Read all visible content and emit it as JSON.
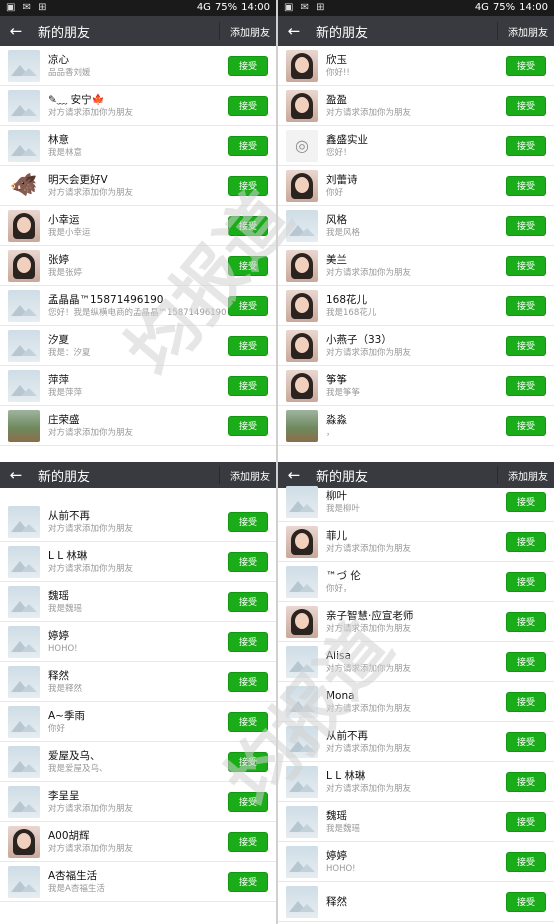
{
  "status_bar": {
    "battery": "75%",
    "time": "14:00",
    "network": "4G"
  },
  "header": {
    "title": "新的朋友",
    "action": "添加朋友"
  },
  "accept_label": "接受",
  "panels": [
    {
      "id": "top-left",
      "rows": [
        {
          "name": "凉心",
          "sub": "品品香刘媛",
          "avatar": "placeholder"
        },
        {
          "name": "✎﹏ 安宁🍁",
          "sub": "对方请求添加你为朋友",
          "avatar": "placeholder"
        },
        {
          "name": "林意",
          "sub": "我是林意",
          "avatar": "placeholder"
        },
        {
          "name": "明天会更好V",
          "sub": "对方请求添加你为朋友",
          "avatar": "animal"
        },
        {
          "name": "小幸运",
          "sub": "我是小幸运",
          "avatar": "person"
        },
        {
          "name": "张婷",
          "sub": "我是张婷",
          "avatar": "person"
        },
        {
          "name": "孟晶晶™15871496190",
          "sub": "您好！我是纵横电商的孟晶晶™15871496190",
          "avatar": "placeholder"
        },
        {
          "name": "汐夏",
          "sub": "我是：汐夏",
          "avatar": "placeholder"
        },
        {
          "name": "萍萍",
          "sub": "我是萍萍",
          "avatar": "placeholder"
        },
        {
          "name": "庄荣盛",
          "sub": "对方请求添加你为朋友",
          "avatar": "scenery"
        }
      ]
    },
    {
      "id": "top-right",
      "rows": [
        {
          "name": "欣玉",
          "sub": "你好!!",
          "avatar": "person"
        },
        {
          "name": "盈盈",
          "sub": "对方请求添加你为朋友",
          "avatar": "person"
        },
        {
          "name": "鑫盛实业",
          "sub": "您好！",
          "avatar": "logo"
        },
        {
          "name": "刘蕾诗",
          "sub": "你好",
          "avatar": "person"
        },
        {
          "name": "风格",
          "sub": "我是风格",
          "avatar": "placeholder"
        },
        {
          "name": "美兰",
          "sub": "对方请求添加你为朋友",
          "avatar": "person"
        },
        {
          "name": "168花儿",
          "sub": "我是168花儿",
          "avatar": "person"
        },
        {
          "name": "小燕子（33）",
          "sub": "对方请求添加你为朋友",
          "avatar": "person"
        },
        {
          "name": "筝筝",
          "sub": "我是筝筝",
          "avatar": "person"
        },
        {
          "name": "淼淼",
          "sub": "，",
          "avatar": "scenery"
        }
      ]
    },
    {
      "id": "bottom-left",
      "rows": [
        {
          "name": "从前不再",
          "sub": "对方请求添加你为朋友",
          "avatar": "placeholder"
        },
        {
          "name": "L L 林琳",
          "sub": "对方请求添加你为朋友",
          "avatar": "placeholder"
        },
        {
          "name": "魏瑶",
          "sub": "我是魏瑶",
          "avatar": "placeholder"
        },
        {
          "name": "婷婷",
          "sub": "HOHO!",
          "avatar": "placeholder"
        },
        {
          "name": "释然",
          "sub": "我是释然",
          "avatar": "placeholder"
        },
        {
          "name": "A~季雨",
          "sub": "你好",
          "avatar": "placeholder"
        },
        {
          "name": "爱屋及乌、",
          "sub": "我是爱屋及乌、",
          "avatar": "placeholder"
        },
        {
          "name": "李呈呈",
          "sub": "对方请求添加你为朋友",
          "avatar": "placeholder"
        },
        {
          "name": "A00胡辉",
          "sub": "对方请求添加你为朋友",
          "avatar": "person"
        },
        {
          "name": "A杏福生活",
          "sub": "我是A杏福生活",
          "avatar": "placeholder"
        }
      ]
    },
    {
      "id": "bottom-right",
      "rows": [
        {
          "name": "柳叶",
          "sub": "我是柳叶",
          "avatar": "placeholder"
        },
        {
          "name": "菲儿",
          "sub": "对方请求添加你为朋友",
          "avatar": "person"
        },
        {
          "name": "™づ 伦",
          "sub": "你好，",
          "avatar": "placeholder"
        },
        {
          "name": "亲子智慧·应宣老师",
          "sub": "对方请求添加你为朋友",
          "avatar": "person"
        },
        {
          "name": "Alisa",
          "sub": "对方请求添加你为朋友",
          "avatar": "placeholder"
        },
        {
          "name": "Mona",
          "sub": "对方请求添加你为朋友",
          "avatar": "placeholder"
        },
        {
          "name": "从前不再",
          "sub": "对方请求添加你为朋友",
          "avatar": "placeholder"
        },
        {
          "name": "L L 林琳",
          "sub": "对方请求添加你为朋友",
          "avatar": "placeholder"
        },
        {
          "name": "魏瑶",
          "sub": "我是魏瑶",
          "avatar": "placeholder"
        },
        {
          "name": "婷婷",
          "sub": "HOHO!",
          "avatar": "placeholder"
        },
        {
          "name": "释然",
          "sub": "",
          "avatar": "placeholder"
        }
      ]
    }
  ],
  "watermark": "均报道",
  "colors": {
    "titlebar": "#393a3f",
    "accept": "#1aad19",
    "status_bar": "#1a1a1a"
  }
}
